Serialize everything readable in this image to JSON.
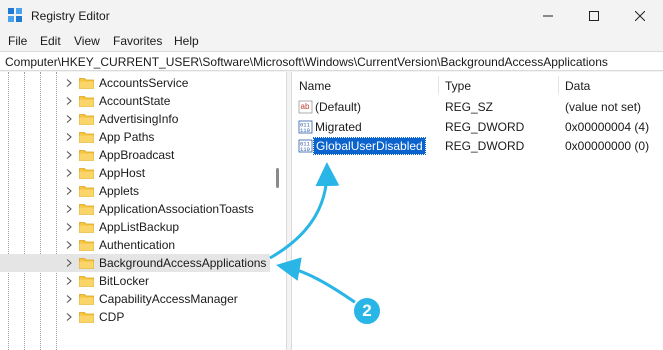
{
  "window": {
    "title": "Registry Editor",
    "icon": "registry-editor-icon"
  },
  "menu": [
    "File",
    "Edit",
    "View",
    "Favorites",
    "Help"
  ],
  "address": "Computer\\HKEY_CURRENT_USER\\Software\\Microsoft\\Windows\\CurrentVersion\\BackgroundAccessApplications",
  "tree": {
    "items": [
      {
        "label": "AccountsService"
      },
      {
        "label": "AccountState"
      },
      {
        "label": "AdvertisingInfo"
      },
      {
        "label": "App Paths"
      },
      {
        "label": "AppBroadcast"
      },
      {
        "label": "AppHost"
      },
      {
        "label": "Applets"
      },
      {
        "label": "ApplicationAssociationToasts"
      },
      {
        "label": "AppListBackup"
      },
      {
        "label": "Authentication"
      },
      {
        "label": "BackgroundAccessApplications",
        "selected": true
      },
      {
        "label": "BitLocker"
      },
      {
        "label": "CapabilityAccessManager"
      },
      {
        "label": "CDP"
      }
    ]
  },
  "list": {
    "columns": [
      "Name",
      "Type",
      "Data"
    ],
    "rows": [
      {
        "icon": "string-value-icon",
        "name": "(Default)",
        "type": "REG_SZ",
        "data": "(value not set)"
      },
      {
        "icon": "binary-value-icon",
        "name": "Migrated",
        "type": "REG_DWORD",
        "data": "0x00000004 (4)"
      },
      {
        "icon": "binary-value-icon",
        "name": "GlobalUserDisabled",
        "type": "REG_DWORD",
        "data": "0x00000000 (0)",
        "selected": true
      }
    ]
  },
  "annotation": {
    "badge": "2",
    "color": "#29b6e6"
  },
  "colors": {
    "selection": "#0b63ce",
    "folder": "#f5c542"
  }
}
